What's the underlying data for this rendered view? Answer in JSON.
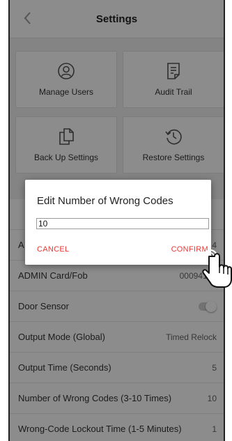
{
  "header": {
    "title": "Settings",
    "back_icon": "chevron-left-icon"
  },
  "tiles": [
    {
      "label": "Manage Users",
      "icon": "user-circle-icon"
    },
    {
      "label": "Audit Trail",
      "icon": "document-list-icon"
    },
    {
      "label": "Back Up Settings",
      "icon": "copy-files-icon"
    },
    {
      "label": "Restore Settings",
      "icon": "history-clock-icon"
    }
  ],
  "rows": [
    {
      "label": "",
      "value": ""
    },
    {
      "label": "A",
      "value": "4"
    },
    {
      "label": "ADMIN Card/Fob",
      "value": "00094170"
    },
    {
      "label": "Door Sensor",
      "value": ""
    },
    {
      "label": "Output Mode (Global)",
      "value": "Timed Relock"
    },
    {
      "label": "Output Time (Seconds)",
      "value": "5"
    },
    {
      "label": "Number of Wrong Codes (3-10 Times)",
      "value": "10"
    },
    {
      "label": "Wrong-Code Lockout Time (1-5 Minutes)",
      "value": "1"
    }
  ],
  "dialog": {
    "title": "Edit Number of Wrong Codes",
    "input_value": "10",
    "cancel_label": "CANCEL",
    "confirm_label": "CONFIRM"
  },
  "colors": {
    "accent_red": "#e53935",
    "overlay": "rgba(0,0,0,0.45)"
  }
}
